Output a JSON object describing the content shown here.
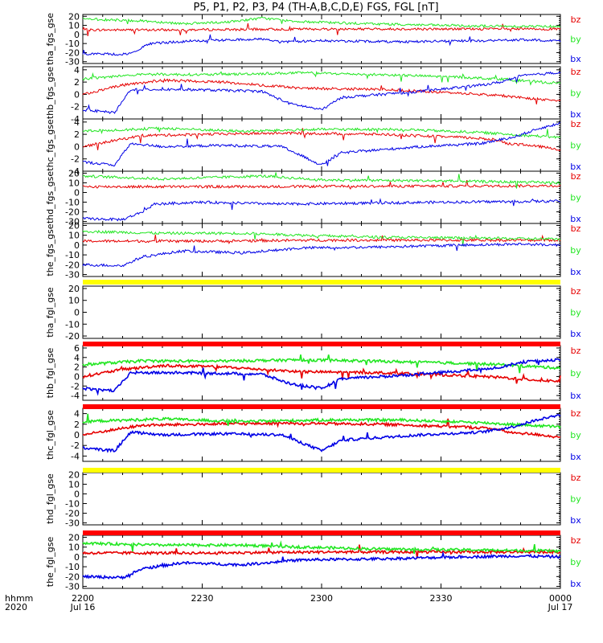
{
  "title": "P5, P1, P2, P3, P4 (TH-A,B,C,D,E) FGS, FGL [nT]",
  "colors": {
    "bx": "#0000e6",
    "by": "#22e622",
    "bz": "#e60000",
    "flag_yellow": "#ffff00",
    "flag_red": "#ff0000"
  },
  "components": [
    "bz",
    "by",
    "bx"
  ],
  "x_axis": {
    "row_label_top": "hhmm",
    "row_label_bottom": "2020",
    "ticks": [
      {
        "hhmm": "2200",
        "date": "Jul 16"
      },
      {
        "hhmm": "2230",
        "date": ""
      },
      {
        "hhmm": "2300",
        "date": ""
      },
      {
        "hhmm": "2330",
        "date": ""
      },
      {
        "hhmm": "0000",
        "date": "Jul 17"
      }
    ]
  },
  "chart_data": [
    {
      "type": "line",
      "ylabel": "tha_fgs_gse",
      "ylim": [
        -32,
        22
      ],
      "yticks": [
        20,
        10,
        0,
        -10,
        -20,
        -30
      ],
      "series": [
        {
          "name": "bz",
          "points": [
            [
              0,
              5
            ],
            [
              20,
              5
            ],
            [
              40,
              5.5
            ],
            [
              60,
              6
            ],
            [
              80,
              6
            ],
            [
              100,
              6
            ],
            [
              120,
              6
            ]
          ]
        },
        {
          "name": "by",
          "points": [
            [
              0,
              17
            ],
            [
              15,
              15
            ],
            [
              25,
              12
            ],
            [
              35,
              13
            ],
            [
              45,
              18
            ],
            [
              55,
              14
            ],
            [
              70,
              12
            ],
            [
              90,
              10
            ],
            [
              105,
              9
            ],
            [
              120,
              9
            ]
          ]
        },
        {
          "name": "bx",
          "points": [
            [
              0,
              -21
            ],
            [
              10,
              -22
            ],
            [
              13,
              -20
            ],
            [
              16,
              -11
            ],
            [
              20,
              -9
            ],
            [
              30,
              -7
            ],
            [
              45,
              -5
            ],
            [
              50,
              -8
            ],
            [
              60,
              -7
            ],
            [
              80,
              -8
            ],
            [
              100,
              -7
            ],
            [
              110,
              -6
            ],
            [
              120,
              -7
            ]
          ]
        }
      ]
    },
    {
      "type": "line",
      "ylabel": "thb_fgs_gse",
      "ylim": [
        -4,
        4.5
      ],
      "yticks": [
        4,
        2,
        0,
        -2,
        -4
      ],
      "series": [
        {
          "name": "bz",
          "points": [
            [
              0,
              0
            ],
            [
              10,
              1.5
            ],
            [
              20,
              2.3
            ],
            [
              35,
              2
            ],
            [
              55,
              1
            ],
            [
              75,
              0.8
            ],
            [
              95,
              0.2
            ],
            [
              105,
              -0.2
            ],
            [
              115,
              -0.8
            ],
            [
              120,
              -1
            ]
          ]
        },
        {
          "name": "by",
          "points": [
            [
              0,
              2.5
            ],
            [
              15,
              3.3
            ],
            [
              30,
              3.2
            ],
            [
              55,
              3.5
            ],
            [
              75,
              3.2
            ],
            [
              95,
              2.8
            ],
            [
              105,
              2.5
            ],
            [
              115,
              2
            ],
            [
              120,
              1.8
            ]
          ]
        },
        {
          "name": "bx",
          "points": [
            [
              0,
              -2.5
            ],
            [
              8,
              -3
            ],
            [
              12,
              0.8
            ],
            [
              25,
              0.8
            ],
            [
              45,
              0.5
            ],
            [
              52,
              -1.5
            ],
            [
              60,
              -2.5
            ],
            [
              65,
              -0.5
            ],
            [
              85,
              0.5
            ],
            [
              100,
              1.5
            ],
            [
              105,
              2
            ],
            [
              110,
              3
            ],
            [
              120,
              3.6
            ]
          ]
        }
      ]
    },
    {
      "type": "line",
      "ylabel": "thc_fgs_gse",
      "ylim": [
        -4,
        4.5
      ],
      "yticks": [
        4,
        2,
        0,
        -2,
        -4
      ],
      "series": [
        {
          "name": "bz",
          "points": [
            [
              0,
              0
            ],
            [
              8,
              1
            ],
            [
              15,
              1.8
            ],
            [
              30,
              2
            ],
            [
              50,
              2.2
            ],
            [
              75,
              2
            ],
            [
              95,
              1.5
            ],
            [
              103,
              1.2
            ],
            [
              107,
              0.5
            ],
            [
              115,
              0
            ],
            [
              120,
              -0.5
            ]
          ]
        },
        {
          "name": "by",
          "points": [
            [
              0,
              2.5
            ],
            [
              20,
              3
            ],
            [
              40,
              2.5
            ],
            [
              60,
              2.8
            ],
            [
              80,
              2.8
            ],
            [
              100,
              2.3
            ],
            [
              107,
              2
            ],
            [
              120,
              1.5
            ]
          ]
        },
        {
          "name": "bx",
          "points": [
            [
              0,
              -2.5
            ],
            [
              8,
              -3
            ],
            [
              12,
              0.5
            ],
            [
              20,
              0
            ],
            [
              35,
              0.2
            ],
            [
              50,
              0
            ],
            [
              55,
              -1.5
            ],
            [
              60,
              -3
            ],
            [
              65,
              -1
            ],
            [
              85,
              0
            ],
            [
              100,
              0.5
            ],
            [
              108,
              1.5
            ],
            [
              115,
              3
            ],
            [
              120,
              3.8
            ]
          ]
        }
      ]
    },
    {
      "type": "line",
      "ylabel": "thd_fgs_gse",
      "ylim": [
        -32,
        22
      ],
      "yticks": [
        20,
        10,
        0,
        -10,
        -20,
        -30
      ],
      "series": [
        {
          "name": "bz",
          "points": [
            [
              0,
              6
            ],
            [
              40,
              6
            ],
            [
              80,
              6.5
            ],
            [
              120,
              7
            ]
          ]
        },
        {
          "name": "by",
          "points": [
            [
              0,
              17
            ],
            [
              20,
              14
            ],
            [
              45,
              17
            ],
            [
              60,
              13
            ],
            [
              90,
              12
            ],
            [
              120,
              10
            ]
          ]
        },
        {
          "name": "bx",
          "points": [
            [
              0,
              -27
            ],
            [
              10,
              -28
            ],
            [
              15,
              -20
            ],
            [
              18,
              -12
            ],
            [
              30,
              -10
            ],
            [
              50,
              -12
            ],
            [
              70,
              -11
            ],
            [
              90,
              -10
            ],
            [
              120,
              -9
            ]
          ]
        }
      ]
    },
    {
      "type": "line",
      "ylabel": "the_fgs_gse",
      "ylim": [
        -32,
        22
      ],
      "yticks": [
        20,
        10,
        0,
        -10,
        -20,
        -30
      ],
      "series": [
        {
          "name": "bz",
          "points": [
            [
              0,
              4
            ],
            [
              30,
              4
            ],
            [
              60,
              5
            ],
            [
              90,
              5
            ],
            [
              120,
              5
            ]
          ]
        },
        {
          "name": "by",
          "points": [
            [
              0,
              14
            ],
            [
              20,
              12
            ],
            [
              40,
              12
            ],
            [
              55,
              10
            ],
            [
              75,
              8
            ],
            [
              100,
              7
            ],
            [
              120,
              6
            ]
          ]
        },
        {
          "name": "bx",
          "points": [
            [
              0,
              -20
            ],
            [
              10,
              -21
            ],
            [
              15,
              -12
            ],
            [
              25,
              -6
            ],
            [
              40,
              -8
            ],
            [
              55,
              -3
            ],
            [
              75,
              -2
            ],
            [
              95,
              0
            ],
            [
              110,
              1
            ],
            [
              120,
              0
            ]
          ]
        }
      ]
    },
    {
      "type": "line",
      "ylabel": "tha_fgl_gse",
      "ylim": [
        -22,
        22
      ],
      "yticks": [
        20,
        10,
        0,
        -10,
        -20
      ],
      "series": []
    },
    {
      "type": "line",
      "ylabel": "thb_fgl_gse",
      "ylim": [
        -5,
        6.5
      ],
      "yticks": [
        6,
        4,
        2,
        0,
        -2,
        -4
      ],
      "series": [
        {
          "name": "bz",
          "points": [
            [
              0,
              0
            ],
            [
              10,
              1.5
            ],
            [
              20,
              2.3
            ],
            [
              35,
              2
            ],
            [
              55,
              1
            ],
            [
              75,
              0.8
            ],
            [
              95,
              0.2
            ],
            [
              105,
              -0.2
            ],
            [
              115,
              -0.8
            ],
            [
              120,
              -1
            ]
          ]
        },
        {
          "name": "by",
          "points": [
            [
              0,
              2.5
            ],
            [
              15,
              3.3
            ],
            [
              30,
              3.2
            ],
            [
              55,
              3.5
            ],
            [
              75,
              3.2
            ],
            [
              95,
              2.8
            ],
            [
              105,
              2.5
            ],
            [
              115,
              2
            ],
            [
              120,
              1.8
            ]
          ]
        },
        {
          "name": "bx",
          "points": [
            [
              0,
              -2.5
            ],
            [
              8,
              -3
            ],
            [
              12,
              0.8
            ],
            [
              25,
              0.8
            ],
            [
              45,
              0.5
            ],
            [
              52,
              -1.5
            ],
            [
              60,
              -2.5
            ],
            [
              65,
              -0.5
            ],
            [
              85,
              0.5
            ],
            [
              100,
              1.5
            ],
            [
              105,
              2
            ],
            [
              110,
              3
            ],
            [
              120,
              3.6
            ]
          ]
        }
      ]
    },
    {
      "type": "line",
      "ylabel": "thc_fgl_gse",
      "ylim": [
        -5,
        5
      ],
      "yticks": [
        4,
        2,
        0,
        -2,
        -4
      ],
      "series": [
        {
          "name": "bz",
          "points": [
            [
              0,
              0
            ],
            [
              8,
              1
            ],
            [
              15,
              1.8
            ],
            [
              30,
              2
            ],
            [
              50,
              2.2
            ],
            [
              75,
              2
            ],
            [
              95,
              1.5
            ],
            [
              103,
              1.2
            ],
            [
              107,
              0.5
            ],
            [
              115,
              0
            ],
            [
              120,
              -0.5
            ]
          ]
        },
        {
          "name": "by",
          "points": [
            [
              0,
              2.5
            ],
            [
              20,
              3
            ],
            [
              40,
              2.5
            ],
            [
              60,
              2.8
            ],
            [
              80,
              2.8
            ],
            [
              100,
              2.3
            ],
            [
              107,
              2
            ],
            [
              120,
              1.5
            ]
          ]
        },
        {
          "name": "bx",
          "points": [
            [
              0,
              -2.5
            ],
            [
              8,
              -3
            ],
            [
              12,
              0.5
            ],
            [
              20,
              0
            ],
            [
              35,
              0.2
            ],
            [
              50,
              0
            ],
            [
              55,
              -1.5
            ],
            [
              60,
              -3
            ],
            [
              65,
              -1
            ],
            [
              85,
              0
            ],
            [
              100,
              0.5
            ],
            [
              108,
              1.5
            ],
            [
              115,
              3
            ],
            [
              120,
              3.8
            ]
          ]
        }
      ]
    },
    {
      "type": "line",
      "ylabel": "thd_fgl_gse",
      "ylim": [
        -32,
        22
      ],
      "yticks": [
        20,
        10,
        0,
        -10,
        -20,
        -30
      ],
      "series": []
    },
    {
      "type": "line",
      "ylabel": "the_fgl_gse",
      "ylim": [
        -32,
        22
      ],
      "yticks": [
        20,
        10,
        0,
        -10,
        -20,
        -30
      ],
      "series": [
        {
          "name": "bz",
          "points": [
            [
              0,
              4
            ],
            [
              30,
              4
            ],
            [
              60,
              5
            ],
            [
              90,
              5
            ],
            [
              120,
              5
            ]
          ]
        },
        {
          "name": "by",
          "points": [
            [
              0,
              14
            ],
            [
              20,
              12
            ],
            [
              40,
              12
            ],
            [
              55,
              10
            ],
            [
              75,
              8
            ],
            [
              100,
              7
            ],
            [
              120,
              6
            ]
          ]
        },
        {
          "name": "bx",
          "points": [
            [
              0,
              -20
            ],
            [
              10,
              -21
            ],
            [
              15,
              -12
            ],
            [
              25,
              -6
            ],
            [
              40,
              -8
            ],
            [
              55,
              -3
            ],
            [
              75,
              -2
            ],
            [
              95,
              0
            ],
            [
              110,
              1
            ],
            [
              120,
              0
            ]
          ]
        }
      ]
    }
  ],
  "flag_bars": [
    {
      "after_panel": 4,
      "color": "yellow"
    },
    {
      "after_panel": 5,
      "color": "red"
    },
    {
      "after_panel": 6,
      "color": "red"
    },
    {
      "after_panel": 7,
      "color": "yellow"
    },
    {
      "after_panel": 8,
      "color": "red"
    }
  ]
}
